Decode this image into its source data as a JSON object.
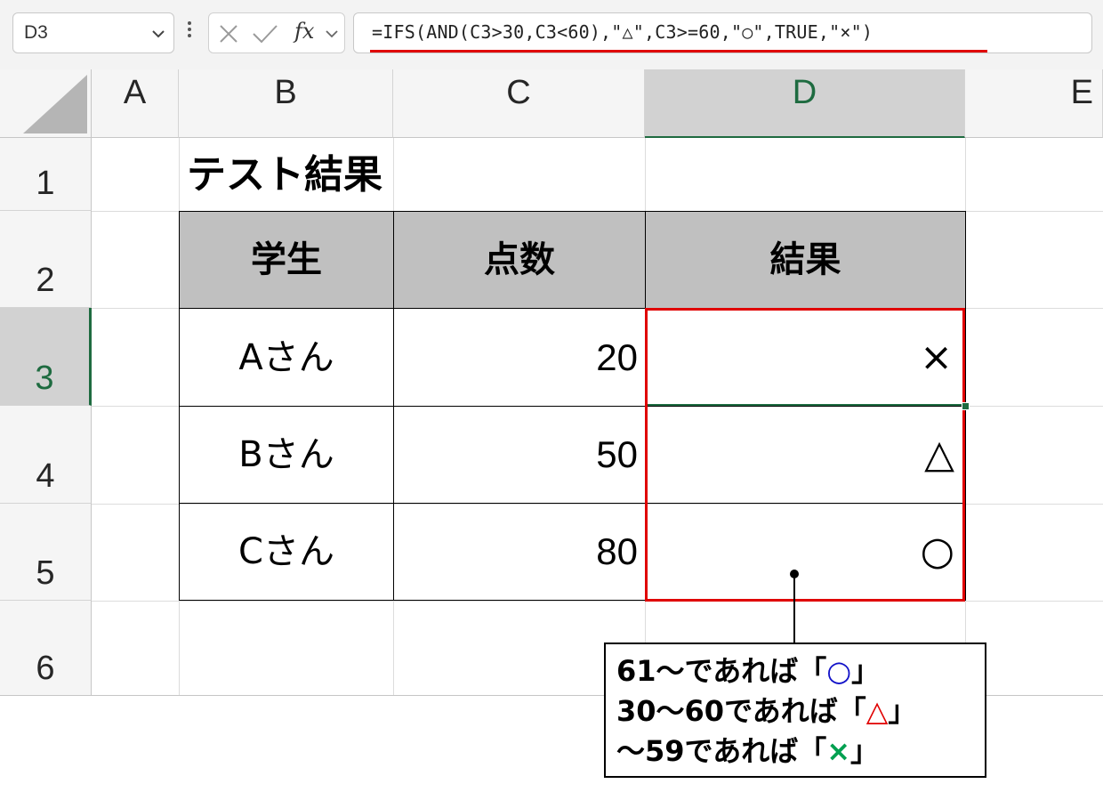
{
  "formula_bar": {
    "name_box": "D3",
    "formula": "=IFS(AND(C3>30,C3<60),\"△\",C3>=60,\"○\",TRUE,\"×\")",
    "fx_label": "fx"
  },
  "columns": [
    "A",
    "B",
    "C",
    "D",
    "E"
  ],
  "rows": [
    "1",
    "2",
    "3",
    "4",
    "5",
    "6"
  ],
  "active_column": "D",
  "active_row": "3",
  "sheet": {
    "title": "テスト結果",
    "headers": [
      "学生",
      "点数",
      "結果"
    ],
    "records": [
      {
        "student": "Aさん",
        "score": "20",
        "result": "×"
      },
      {
        "student": "Bさん",
        "score": "50",
        "result": "△"
      },
      {
        "student": "Cさん",
        "score": "80",
        "result": "○"
      }
    ]
  },
  "callout": {
    "line1_pre": "61～であれば「",
    "line1_sym": "○",
    "line1_post": "」",
    "line2_pre": "30～60であれば「",
    "line2_sym": "△",
    "line2_post": "」",
    "line3_pre": "～59であれば「",
    "line3_sym": "×",
    "line3_post": "」"
  },
  "colors": {
    "highlight_red": "#e00000",
    "selection_green": "#1e6b40",
    "circle_blue": "#1010c8",
    "cross_green": "#00a050",
    "header_gray": "#c0c0c0"
  }
}
